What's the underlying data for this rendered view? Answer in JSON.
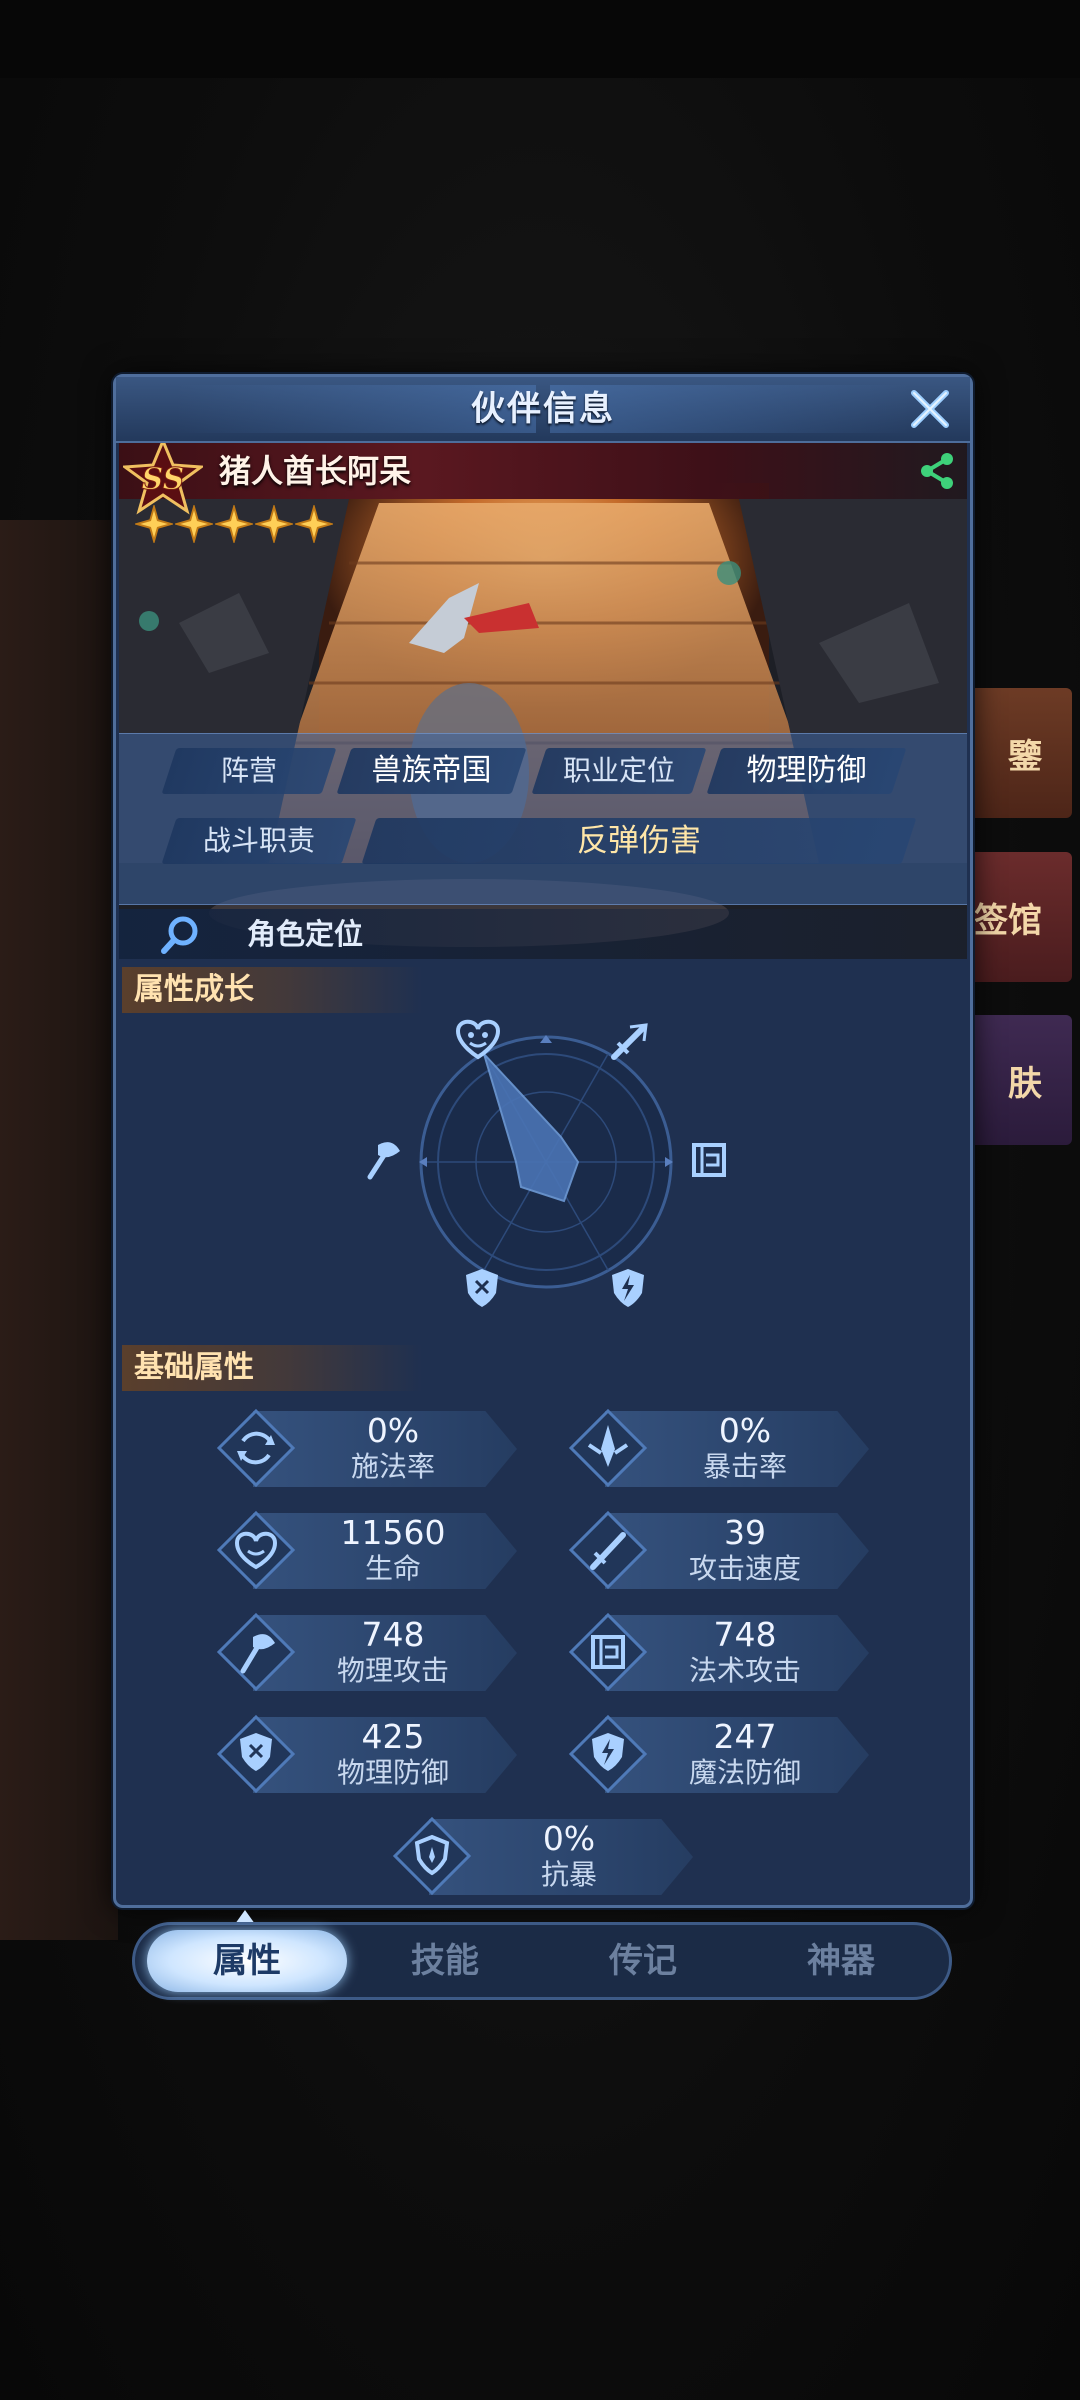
{
  "panel": {
    "title": "伙伴信息"
  },
  "hero": {
    "rank": "SS",
    "name": "猪人酋长阿呆",
    "star_count": 5,
    "info": {
      "faction_label": "阵营",
      "faction_value": "兽族帝国",
      "role_label": "职业定位",
      "role_value": "物理防御",
      "duty_label": "战斗职责",
      "duty_value": "反弹伤害"
    },
    "locate_label": "角色定位"
  },
  "growth": {
    "title": "属性成长"
  },
  "base": {
    "title": "基础属性",
    "stats": [
      {
        "value": "0%",
        "label": "施法率",
        "icon": "cycle-icon"
      },
      {
        "value": "0%",
        "label": "暴击率",
        "icon": "crit-icon"
      },
      {
        "value": "11560",
        "label": "生命",
        "icon": "heart-icon"
      },
      {
        "value": "39",
        "label": "攻击速度",
        "icon": "slash-icon"
      },
      {
        "value": "748",
        "label": "物理攻击",
        "icon": "axe-icon"
      },
      {
        "value": "748",
        "label": "法术攻击",
        "icon": "spellbook-icon"
      },
      {
        "value": "425",
        "label": "物理防御",
        "icon": "shield-axe-icon"
      },
      {
        "value": "247",
        "label": "魔法防御",
        "icon": "lightning-shield-icon"
      },
      {
        "value": "0%",
        "label": "抗暴",
        "icon": "shield-icon"
      }
    ]
  },
  "tabs": [
    "属性",
    "技能",
    "传记",
    "神器"
  ],
  "active_tab": "属性",
  "background": {
    "buttons": [
      "鑒",
      "签馆",
      "肤"
    ]
  },
  "colors": {
    "panel": "#1f3050",
    "accent_gold": "#ffe2b0",
    "radar_fill": "#4a74b4"
  }
}
